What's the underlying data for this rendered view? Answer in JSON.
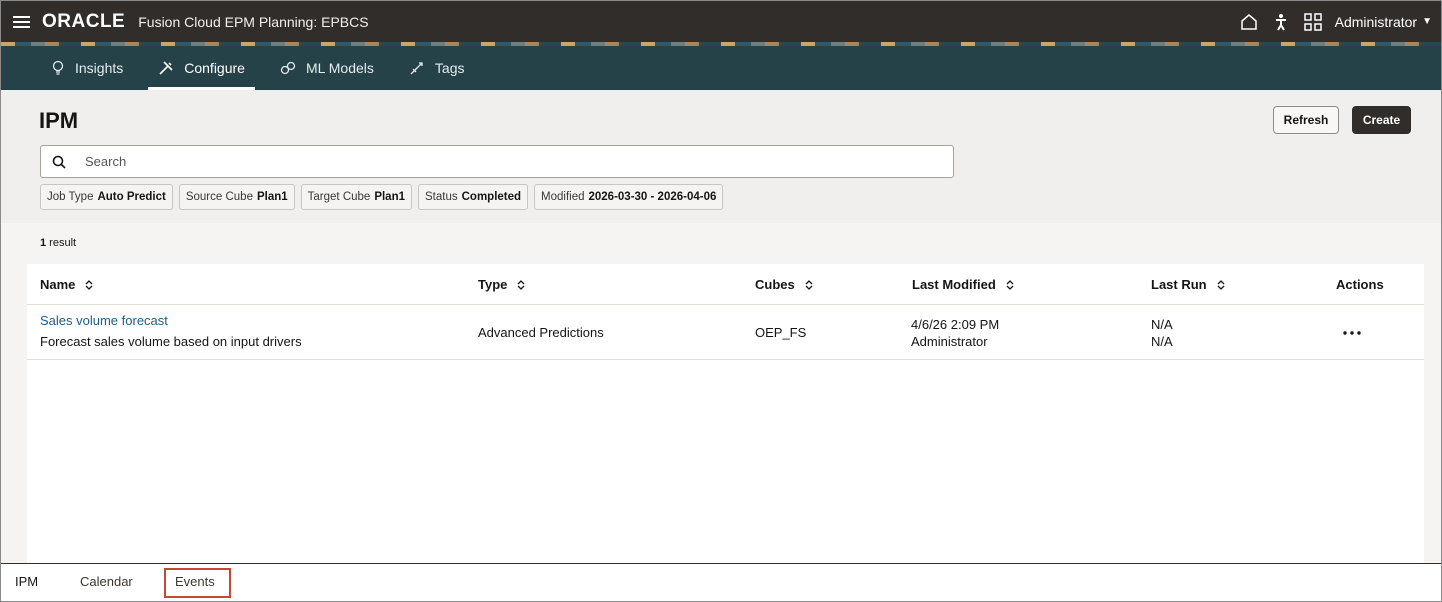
{
  "header": {
    "logo": "ORACLE",
    "app_title": "Fusion Cloud EPM Planning:  EPBCS",
    "user": "Administrator",
    "icons": [
      "menu-icon",
      "home-icon",
      "accessibility-icon",
      "grid-icon"
    ]
  },
  "nav": {
    "tabs": [
      {
        "label": "Insights",
        "icon": "lightbulb-icon"
      },
      {
        "label": "Configure",
        "icon": "tools-icon"
      },
      {
        "label": "ML Models",
        "icon": "ml-icon"
      },
      {
        "label": "Tags",
        "icon": "tag-icon"
      }
    ],
    "active": "Configure"
  },
  "page": {
    "title": "IPM",
    "refresh_label": "Refresh",
    "create_label": "Create",
    "search_placeholder": "Search"
  },
  "filters": [
    {
      "label": "Job Type",
      "value": "Auto Predict"
    },
    {
      "label": "Source Cube",
      "value": "Plan1"
    },
    {
      "label": "Target Cube",
      "value": "Plan1"
    },
    {
      "label": "Status",
      "value": "Completed"
    },
    {
      "label": "Modified",
      "value": "2026-03-30 - 2026-04-06"
    }
  ],
  "results": {
    "count": "1",
    "count_suffix": " result"
  },
  "table": {
    "columns": [
      "Name",
      "Type",
      "Cubes",
      "Last Modified",
      "Last Run",
      "Actions"
    ],
    "rows": [
      {
        "name": "Sales volume forecast",
        "description": "Forecast sales volume based on input drivers",
        "type": "Advanced Predictions",
        "cubes": "OEP_FS",
        "last_modified_date": "4/6/26 2:09 PM",
        "last_modified_by": "Administrator",
        "last_run_1": "N/A",
        "last_run_2": "N/A"
      }
    ]
  },
  "bottom_tabs": [
    "IPM",
    "Calendar",
    "Events"
  ],
  "colors": {
    "header_bg": "#312d2a",
    "nav_bg": "#264249",
    "link": "#1a5e8a",
    "highlight_box": "#c74634"
  }
}
